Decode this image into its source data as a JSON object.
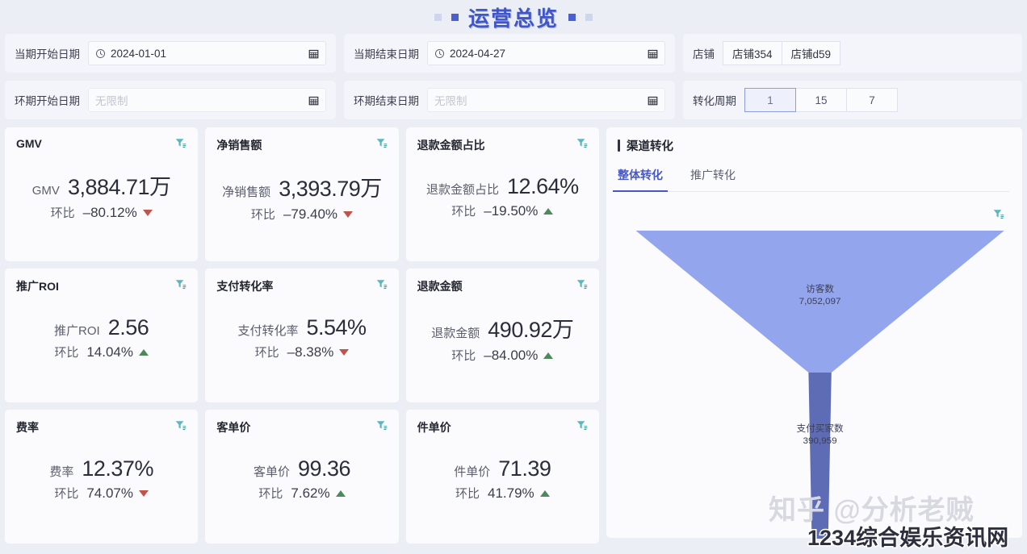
{
  "header": {
    "title": "运营总览"
  },
  "filters": {
    "current_start": {
      "label": "当期开始日期",
      "value": "2024-01-01",
      "placeholder": ""
    },
    "current_end": {
      "label": "当期结束日期",
      "value": "2024-04-27",
      "placeholder": ""
    },
    "compare_start": {
      "label": "环期开始日期",
      "value": "",
      "placeholder": "无限制"
    },
    "compare_end": {
      "label": "环期结束日期",
      "value": "",
      "placeholder": "无限制"
    },
    "shop": {
      "label": "店铺",
      "options": [
        "店铺354",
        "店铺d59"
      ]
    },
    "conversion_period": {
      "label": "转化周期",
      "options": [
        "1",
        "15",
        "7"
      ],
      "selected": "1"
    }
  },
  "cards": [
    {
      "title": "GMV",
      "metric_label": "GMV",
      "value": "3,884.71万",
      "compare_label": "环比",
      "compare_value": "–80.12%",
      "direction": "down"
    },
    {
      "title": "净销售额",
      "metric_label": "净销售额",
      "value": "3,393.79万",
      "compare_label": "环比",
      "compare_value": "–79.40%",
      "direction": "down"
    },
    {
      "title": "退款金额占比",
      "metric_label": "退款金额占比",
      "value": "12.64%",
      "compare_label": "环比",
      "compare_value": "–19.50%",
      "direction": "up"
    },
    {
      "title": "推广ROI",
      "metric_label": "推广ROI",
      "value": "2.56",
      "compare_label": "环比",
      "compare_value": "14.04%",
      "direction": "up"
    },
    {
      "title": "支付转化率",
      "metric_label": "支付转化率",
      "value": "5.54%",
      "compare_label": "环比",
      "compare_value": "–8.38%",
      "direction": "down"
    },
    {
      "title": "退款金额",
      "metric_label": "退款金额",
      "value": "490.92万",
      "compare_label": "环比",
      "compare_value": "–84.00%",
      "direction": "up"
    },
    {
      "title": "费率",
      "metric_label": "费率",
      "value": "12.37%",
      "compare_label": "环比",
      "compare_value": "74.07%",
      "direction": "down"
    },
    {
      "title": "客单价",
      "metric_label": "客单价",
      "value": "99.36",
      "compare_label": "环比",
      "compare_value": "7.62%",
      "direction": "up"
    },
    {
      "title": "件单价",
      "metric_label": "件单价",
      "value": "71.39",
      "compare_label": "环比",
      "compare_value": "41.79%",
      "direction": "up"
    }
  ],
  "panel": {
    "title": "渠道转化",
    "tabs": [
      {
        "label": "整体转化",
        "active": true
      },
      {
        "label": "推广转化",
        "active": false
      }
    ]
  },
  "chart_data": {
    "type": "funnel",
    "title": "渠道转化",
    "stages": [
      {
        "name": "访客数",
        "value": 7052097,
        "display": "7,052,097",
        "color": "#93a5ec"
      },
      {
        "name": "支付买家数",
        "value": 390959,
        "display": "390,959",
        "color": "#5d6cb5"
      }
    ],
    "conversion_rate": "5.54%"
  },
  "watermarks": {
    "zhihu": "知乎 @分析老贼",
    "site": "1234综合娱乐资讯网"
  },
  "colors": {
    "accent": "#4558c5",
    "background": "#eceef6",
    "card": "#fbfbfd",
    "up": "#4c8a5c",
    "down": "#c0544a",
    "filter_icon": "#3f9c9c",
    "funnel_top": "#93a5ec",
    "funnel_bottom": "#5d6cb5"
  }
}
